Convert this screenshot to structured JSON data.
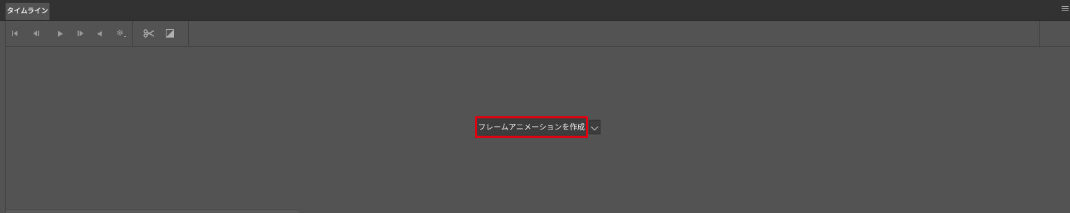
{
  "panel": {
    "tab_label": "タイムライン",
    "menu_icon": "hamburger-menu-icon"
  },
  "toolbar": {
    "buttons": [
      {
        "icon": "first-frame-icon"
      },
      {
        "icon": "previous-frame-icon"
      },
      {
        "icon": "play-icon"
      },
      {
        "icon": "next-frame-icon"
      },
      {
        "icon": "audio-icon"
      },
      {
        "icon": "settings-gear-icon"
      },
      {
        "icon": "scissors-icon"
      },
      {
        "icon": "transition-icon"
      }
    ]
  },
  "main": {
    "create_button_label": "フレームアニメーションを作成",
    "dropdown_icon": "chevron-down-icon",
    "highlight_color": "#e0000f"
  },
  "colors": {
    "panel_bg": "#535353",
    "tabbar_bg": "#323232",
    "icon_color": "#9a9a9a"
  }
}
